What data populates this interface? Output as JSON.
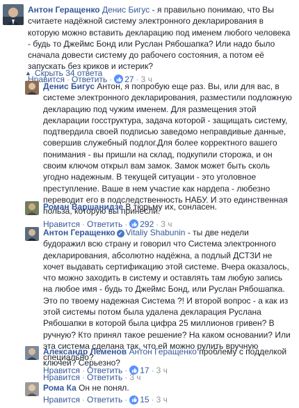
{
  "comments": [
    {
      "author": "Антон Геращенко",
      "mention": "Денис Бигус",
      "text": " - я правильно понимаю, что Вы считаете надёжной систему электронного декларирования в которую можно вставить декларацию под именем любого человека - будь то Джеймс Бонд или Руслан Рябошапка? Или надо было сначала довести систему до рабочего состояния, а потом её запускать без криков и истерик?",
      "actions": {
        "like": "Нравится",
        "reply": "Ответить",
        "reactions": "27",
        "time": "3 ч"
      }
    }
  ],
  "toggle": {
    "label": "Скрыть 34 ответа"
  },
  "replies": [
    {
      "author": "Денис Бигус",
      "mention": "",
      "text": " Антон, я попробую еще раз. Вы, или для вас, в системе электронного декларирования, разместили подложную декларацию под чужим именем. Для размещения этой декларации госструктура, задача которой - защищать систему, подтвердила своей подписью заведомо неправдивые данные, совершив служебный подлог.Для более корректного вашего понимания - вы пришли на склад, подкупили сторожа, и он своим ключом открыл вам замок. Замок может быть сколь угодно надежным. В текущей ситуации - это уголовное преступление. Ваше в нем участие как нардепа - любезно переводит его в подследственность НАБУ. И это единственная польза, которую вы принесли.",
      "actions": {
        "like": "Нравится",
        "reply": "Ответить",
        "reactions": "292",
        "time": "3 ч"
      }
    },
    {
      "author": "Роман Варшанидзе",
      "mention": "",
      "text": " В тюрьму их, сонласен.",
      "actions": {
        "like": "",
        "reply": "",
        "reactions": "",
        "time": ""
      }
    },
    {
      "author": "Антон Геращенко",
      "mention": "Vitaliy Shabunin",
      "text": " - ты две недели будоражил всю страну и говорил что Система электронного декларирования, абсолютно надёжна, а подлый ДСТЗИ не хочет выдавать сертификацию этой системе. Вчера оказалось, что можно заходить в систему и оставлять там любую запись на любое имя - будь то Джеймс Бонд, или Руслан Рябошапка. Это по твоему надежная Система ?! И второй вопрос - а как из этой системы потом была удалена декларация Руслана Рябошапки в которой была цифра 25 миллионов гривен? В ручную? Кто принял такое решение? На каком основании? Или эта система сделана так, что ей можно рулить вручную специально?",
      "actions": {
        "like": "Нравится",
        "reply": "Ответить",
        "reactions": "17",
        "time": "3 ч"
      }
    },
    {
      "author": "Александр Леменов",
      "mention": "Антон Геращенко",
      "text": " проблему с подделкой ключей? Серьезно?",
      "actions": {
        "like": "Нравится",
        "reply": "Ответить",
        "reactions": "",
        "time": "3 ч"
      }
    },
    {
      "author": "Рома Ка",
      "mention": "",
      "text": " Он не понял.",
      "actions": {
        "like": "Нравится",
        "reply": "Ответить",
        "reactions": "15",
        "time": "3 ч"
      }
    }
  ],
  "colors": {
    "link": "#365899",
    "meta": "#90949c",
    "text": "#1d2129",
    "like": "#5890ff"
  }
}
